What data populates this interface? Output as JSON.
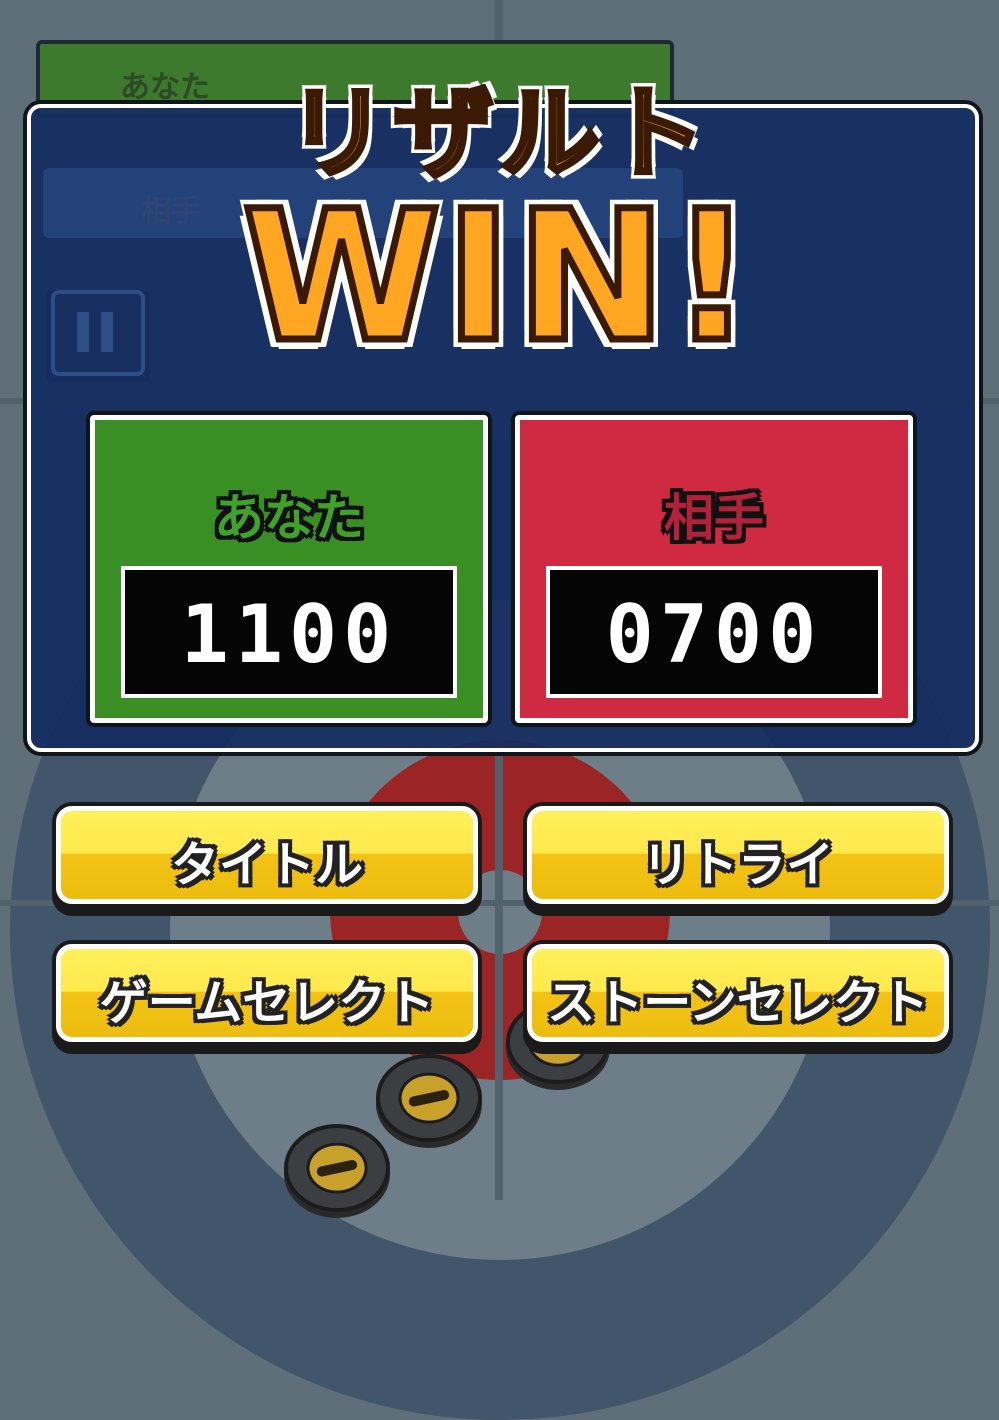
{
  "result": {
    "title": "リザルト",
    "outcome": "WIN!"
  },
  "players": {
    "you": {
      "name": "あなた",
      "score": "1100"
    },
    "opponent": {
      "name": "相手",
      "score": "0700"
    }
  },
  "menu": {
    "title_label": "タイトル",
    "retry_label": "リトライ",
    "game_select_label": "ゲームセレクト",
    "stone_select_label": "ストーンセレクト"
  },
  "hud_background": {
    "you_label": "あなた",
    "opponent_label": "相手"
  },
  "colors": {
    "panel": "#142c60",
    "you_card": "#3a8f24",
    "opponent_card": "#cf2a41",
    "button": "#ffe94d",
    "accent_orange": "#ffa622"
  },
  "icons": [
    "pause-icon",
    "curling-stone-icon"
  ]
}
